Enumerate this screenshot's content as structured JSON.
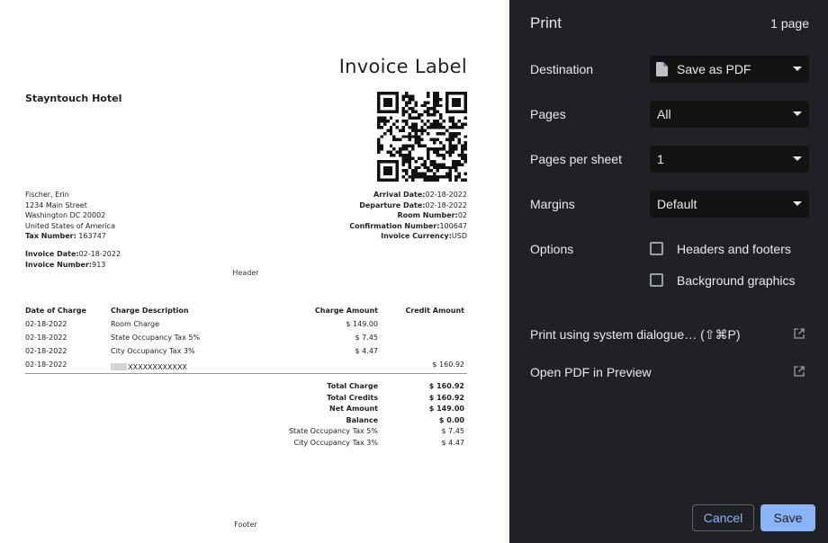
{
  "preview": {
    "doc_title": "Invoice Label",
    "hotel_name": "Stayntouch Hotel",
    "guest": {
      "name": "Fischer, Erin",
      "street": "1234 Main Street",
      "city": "Washington DC 20002",
      "country": "United States of America",
      "tax_label": "Tax Number:",
      "tax_value": " 163747"
    },
    "stay": {
      "arrival_label": "Arrival Date:",
      "arrival_value": "02-18-2022",
      "departure_label": "Departure Date:",
      "departure_value": "02-18-2022",
      "room_label": "Room Number:",
      "room_value": "02",
      "confirmation_label": "Confirmation Number:",
      "confirmation_value": "100647",
      "currency_label": "Invoice Currency:",
      "currency_value": "USD"
    },
    "invoice": {
      "date_label": "Invoice Date:",
      "date_value": "02-18-2022",
      "number_label": "Invoice Number:",
      "number_value": "913"
    },
    "header_label": "Header",
    "footer_label": "Footer",
    "table": {
      "columns": [
        "Date of Charge",
        "Charge Description",
        "Charge Amount",
        "Credit Amount"
      ],
      "rows": [
        {
          "date": "02-18-2022",
          "desc": "Room Charge",
          "charge": "$ 149.00",
          "credit": ""
        },
        {
          "date": "02-18-2022",
          "desc": "State Occupancy Tax 5%",
          "charge": "$ 7.45",
          "credit": ""
        },
        {
          "date": "02-18-2022",
          "desc": "City Occupancy Tax 3%",
          "charge": "$ 4.47",
          "credit": ""
        },
        {
          "date": "02-18-2022",
          "desc": "Visa XXXXXXXXXXXX",
          "charge": "",
          "credit": "$ 160.92"
        }
      ]
    },
    "summary": [
      {
        "label": "Total Charge",
        "value": "$ 160.92",
        "bold": true
      },
      {
        "label": "Total Credits",
        "value": "$ 160.92",
        "bold": true
      },
      {
        "label": "Net Amount",
        "value": "$ 149.00",
        "bold": true
      },
      {
        "label": "Balance",
        "value": "$ 0.00",
        "bold": true
      },
      {
        "label": "State Occupancy Tax 5%",
        "value": "$ 7.45",
        "bold": false
      },
      {
        "label": "City Occupancy Tax 3%",
        "value": "$ 4.47",
        "bold": false
      }
    ]
  },
  "panel": {
    "title": "Print",
    "page_count": "1 page",
    "destination": {
      "label": "Destination",
      "value": "Save as PDF",
      "icon": "file-icon"
    },
    "pages": {
      "label": "Pages",
      "value": "All"
    },
    "pages_per_sheet": {
      "label": "Pages per sheet",
      "value": "1"
    },
    "margins": {
      "label": "Margins",
      "value": "Default"
    },
    "options": {
      "label": "Options",
      "headers_footers": "Headers and footers",
      "background_graphics": "Background graphics"
    },
    "system_dialog": "Print using system dialogue… (⇧⌘P)",
    "open_pdf": "Open PDF in Preview",
    "cancel": "Cancel",
    "save": "Save",
    "colors": {
      "panel_bg": "#202124",
      "accent": "#8ab4f8"
    }
  }
}
